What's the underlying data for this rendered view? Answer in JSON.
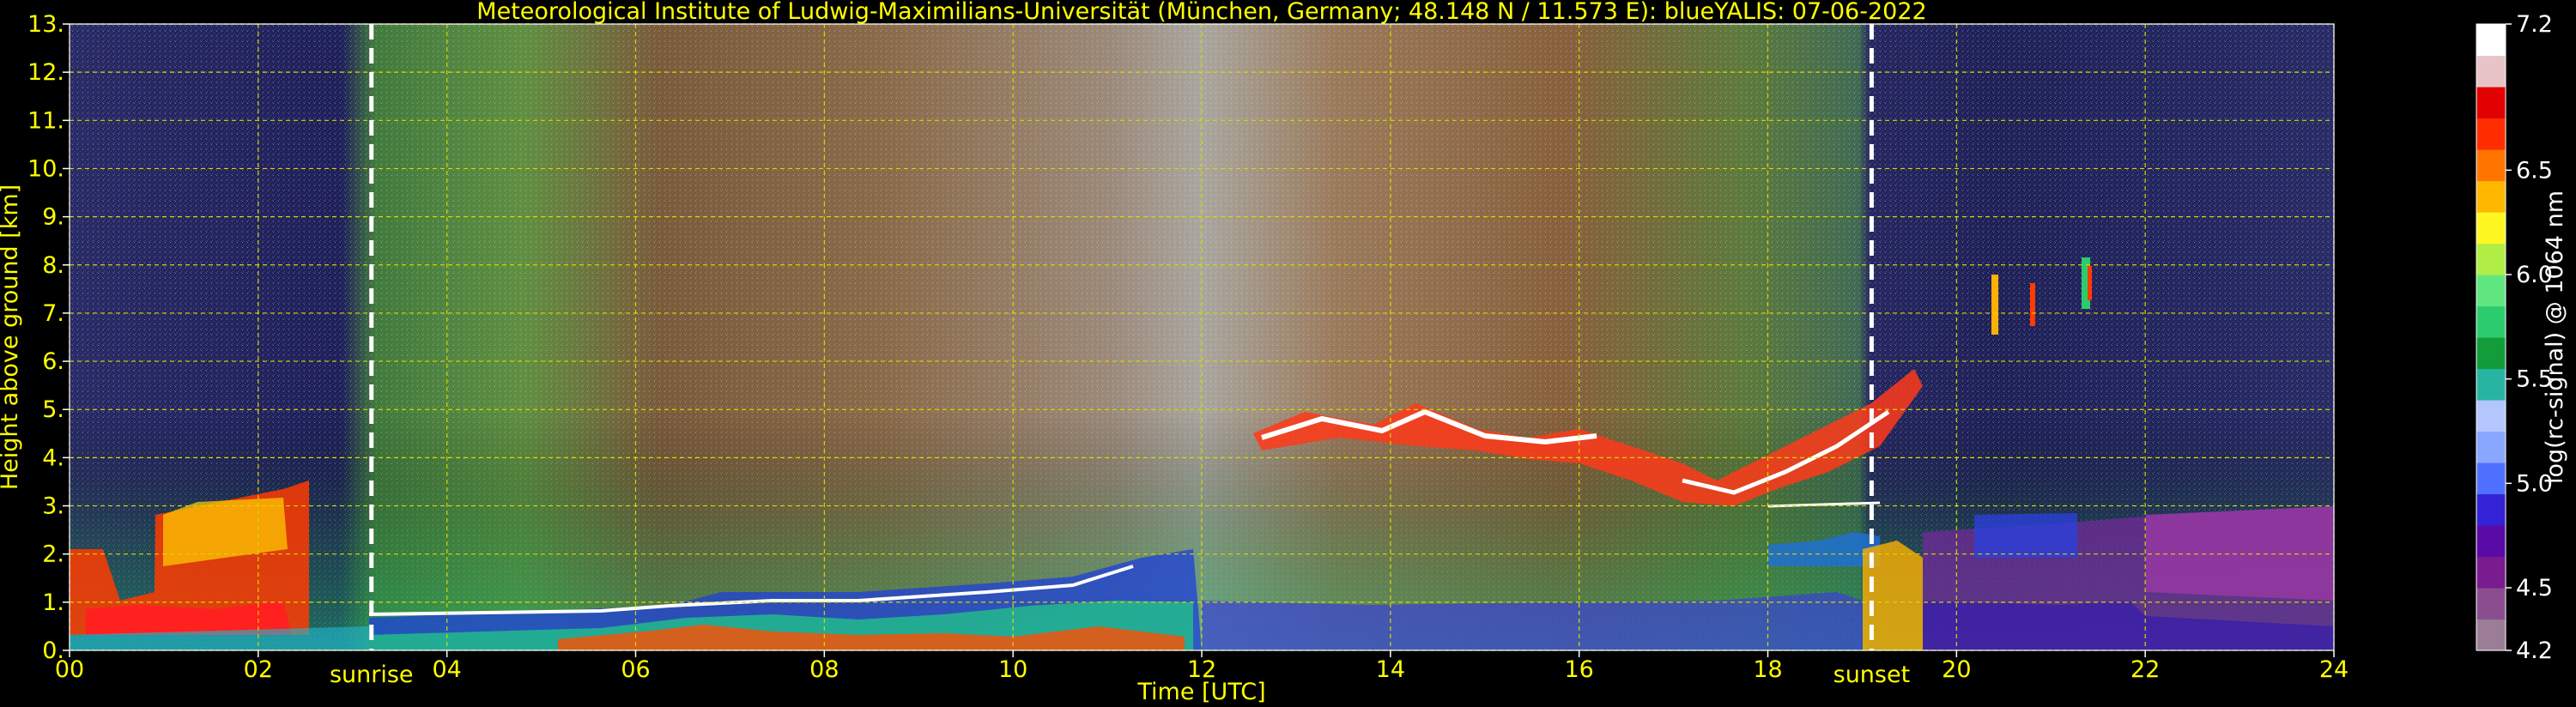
{
  "chart_data": {
    "type": "heatmap",
    "title": "Meteorological Institute of Ludwig-Maximilians-Universität (München, Germany; 48.148 N / 11.573 E):    blueYALIS: 07-06-2022",
    "xlabel": "Time [UTC]",
    "ylabel": "Height above ground [km]",
    "colorbar_label": "log(rc-signal) @ 1064 nm",
    "xlim": [
      0,
      24
    ],
    "ylim": [
      0,
      13
    ],
    "clim": [
      4.2,
      7.2
    ],
    "x_ticks": [
      "00",
      "02",
      "04",
      "06",
      "08",
      "10",
      "12",
      "14",
      "16",
      "18",
      "20",
      "22",
      "24"
    ],
    "y_ticks": [
      "0.",
      "1.",
      "2.",
      "3.",
      "4.",
      "5.",
      "6.",
      "7.",
      "8.",
      "9.",
      "10.",
      "11.",
      "12.",
      "13."
    ],
    "colorbar_ticks": [
      {
        "value": 4.2,
        "label": "4.2"
      },
      {
        "value": 4.5,
        "label": "4.5"
      },
      {
        "value": 5.0,
        "label": "5.0"
      },
      {
        "value": 5.5,
        "label": "5.5"
      },
      {
        "value": 6.0,
        "label": "6.0"
      },
      {
        "value": 6.5,
        "label": "6.5"
      },
      {
        "value": 7.2,
        "label": "7.2"
      }
    ],
    "colormap": [
      "#9c7d96",
      "#8a4e90",
      "#7a1b8f",
      "#5a0aa6",
      "#3422d6",
      "#5070ff",
      "#8aa7ff",
      "#b5c6ff",
      "#28b4a2",
      "#129c3a",
      "#2ccc6e",
      "#60e680",
      "#b0ee46",
      "#fff722",
      "#ffb700",
      "#ff7500",
      "#ff2d00",
      "#e00000",
      "#e8c4c8",
      "#ffffff"
    ],
    "grid": true,
    "grid_color": "#d8d800",
    "text_color": "#ffff00",
    "axes_color": "#ffffff",
    "background": "#000000",
    "annotations": [
      {
        "text": "sunrise",
        "x": 3.2
      },
      {
        "text": "sunset",
        "x": 19.1
      }
    ]
  }
}
